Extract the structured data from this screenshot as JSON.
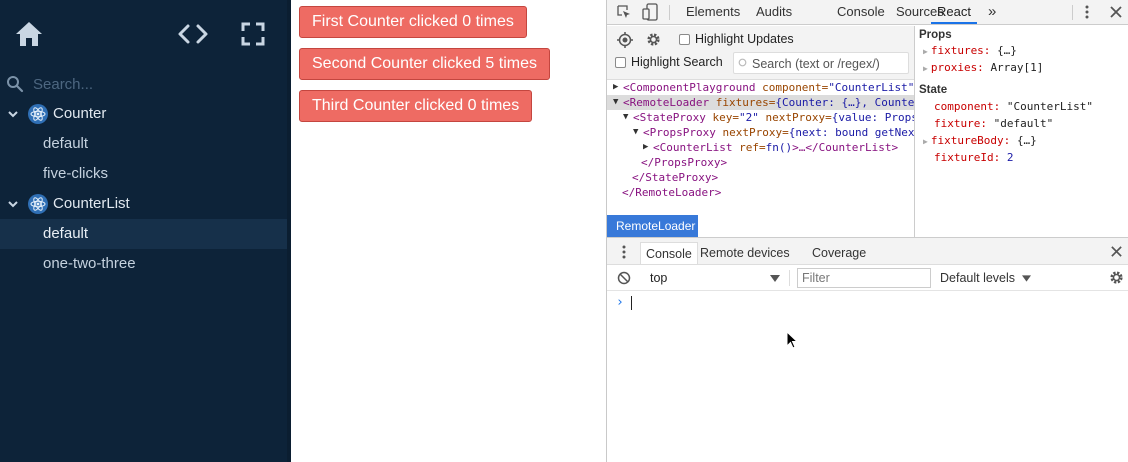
{
  "sidebar": {
    "search_placeholder": "Search...",
    "icons": [
      "home-icon",
      "code-icon",
      "fullscreen-icon",
      "search-icon"
    ],
    "tree": [
      {
        "type": "component",
        "label": "Counter",
        "expanded": true
      },
      {
        "type": "fixture",
        "label": "default",
        "selected": false
      },
      {
        "type": "fixture",
        "label": "five-clicks",
        "selected": false
      },
      {
        "type": "component",
        "label": "CounterList",
        "expanded": true
      },
      {
        "type": "fixture",
        "label": "default",
        "selected": true
      },
      {
        "type": "fixture",
        "label": "one-two-three",
        "selected": false
      }
    ]
  },
  "preview": {
    "buttons": [
      "First Counter clicked 0 times",
      "Second Counter clicked 5 times",
      "Third Counter clicked 0 times"
    ]
  },
  "devtools": {
    "tabs": [
      "Elements",
      "Audits",
      "Console",
      "Sources",
      "React"
    ],
    "active_tab": "React",
    "more_label": "»",
    "react_toolbar": {
      "highlight_updates": "Highlight Updates",
      "highlight_search": "Highlight Search",
      "search_placeholder": "Search (text or /regex/)"
    },
    "tree": {
      "r1": {
        "tag_open": "<ComponentPlayground",
        "attr": " component=",
        "val": "\"CounterList\""
      },
      "r2": {
        "tag_open": "<RemoteLoader",
        "attr": " fixtures=",
        "val": "{Counter: {…}, Counte"
      },
      "r3": {
        "tag_open": "<StateProxy",
        "attr1": " key=",
        "val1": "\"2\"",
        "attr2": " nextProxy=",
        "val2": "{value: Props"
      },
      "r4": {
        "tag_open": "<PropsProxy",
        "attr": " nextProxy=",
        "val": "{next: bound getNex"
      },
      "r5": {
        "tag_open": "<CounterList",
        "attr": " ref=",
        "val": "fn()",
        "rest": ">…</CounterList>"
      },
      "r6": "</PropsProxy>",
      "r7": "</StateProxy>",
      "r8": "</RemoteLoader>"
    },
    "selected_badge": "RemoteLoader",
    "props": {
      "heading": "Props",
      "fixtures_key": "fixtures:",
      "fixtures_val": "{…}",
      "proxies_key": "proxies:",
      "proxies_val": "Array[1]"
    },
    "state": {
      "heading": "State",
      "component_key": "component:",
      "component_val": "\"CounterList\"",
      "fixture_key": "fixture:",
      "fixture_val": "\"default\"",
      "fixtureBody_key": "fixtureBody:",
      "fixtureBody_val": "{…}",
      "fixtureId_key": "fixtureId:",
      "fixtureId_val": "2"
    },
    "drawer": {
      "tabs": [
        "Console",
        "Remote devices",
        "Coverage"
      ],
      "active": "Console",
      "context": "top",
      "filter_placeholder": "Filter",
      "levels": "Default levels",
      "prompt": "›"
    }
  },
  "colors": {
    "sidebar_bg": "#0d2339",
    "button_bg": "#ee6b63",
    "devtools_accent": "#1a73e8",
    "badge_bg": "#3879d9"
  }
}
